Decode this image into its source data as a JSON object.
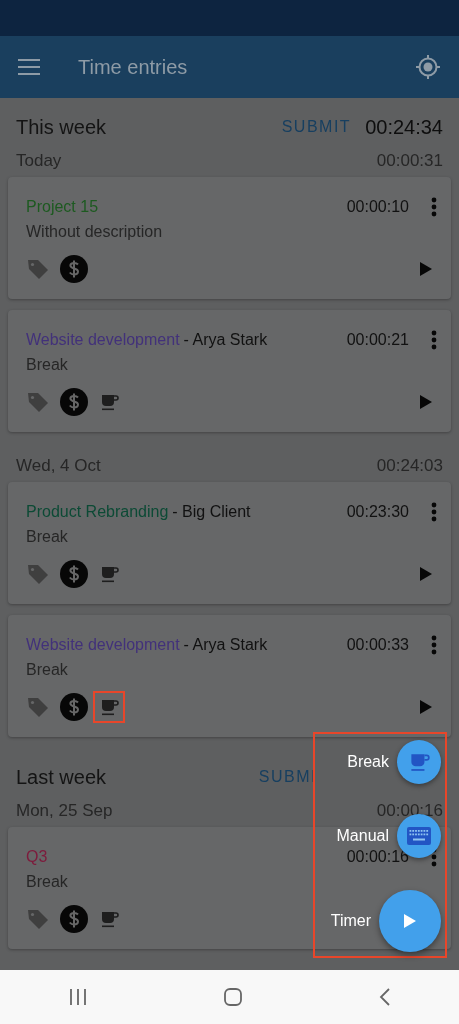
{
  "app_bar": {
    "title": "Time entries"
  },
  "weeks": [
    {
      "title": "This week",
      "submit": "SUBMIT",
      "total": "00:24:34",
      "days": [
        {
          "date": "Today",
          "total": "00:00:31",
          "entries": [
            {
              "project": "Project 15",
              "color": "#1d5a20",
              "description": "Without description",
              "duration": "00:00:10",
              "break": false,
              "highlighted": false
            },
            {
              "project": "Website development",
              "client": "- Arya Stark",
              "color": "#42317a",
              "description": "Break",
              "duration": "00:00:21",
              "break": true,
              "highlighted": false
            }
          ]
        },
        {
          "date": "Wed, 4 Oct",
          "total": "00:24:03",
          "entries": [
            {
              "project": "Product Rebranding",
              "client": "- Big Client",
              "color": "#0c4a35",
              "description": "Break",
              "duration": "00:23:30",
              "break": true,
              "highlighted": false
            },
            {
              "project": "Website development",
              "client": "- Arya Stark",
              "color": "#42317a",
              "description": "Break",
              "duration": "00:00:33",
              "break": true,
              "highlighted": true
            }
          ]
        }
      ]
    },
    {
      "title": "Last week",
      "submit": "SUBMI",
      "days": [
        {
          "date": "Mon, 25 Sep",
          "total": "00:00:16",
          "entries": [
            {
              "project": "Q3",
              "color": "#7d1b3c",
              "description": "Break",
              "duration": "00:00:16",
              "break": true,
              "highlighted": false
            }
          ]
        }
      ]
    }
  ],
  "fab_menu": {
    "highlighted": true,
    "actions": [
      {
        "label": "Break",
        "kind": "break"
      },
      {
        "label": "Manual",
        "kind": "manual"
      },
      {
        "label": "Timer",
        "kind": "timer"
      }
    ]
  }
}
